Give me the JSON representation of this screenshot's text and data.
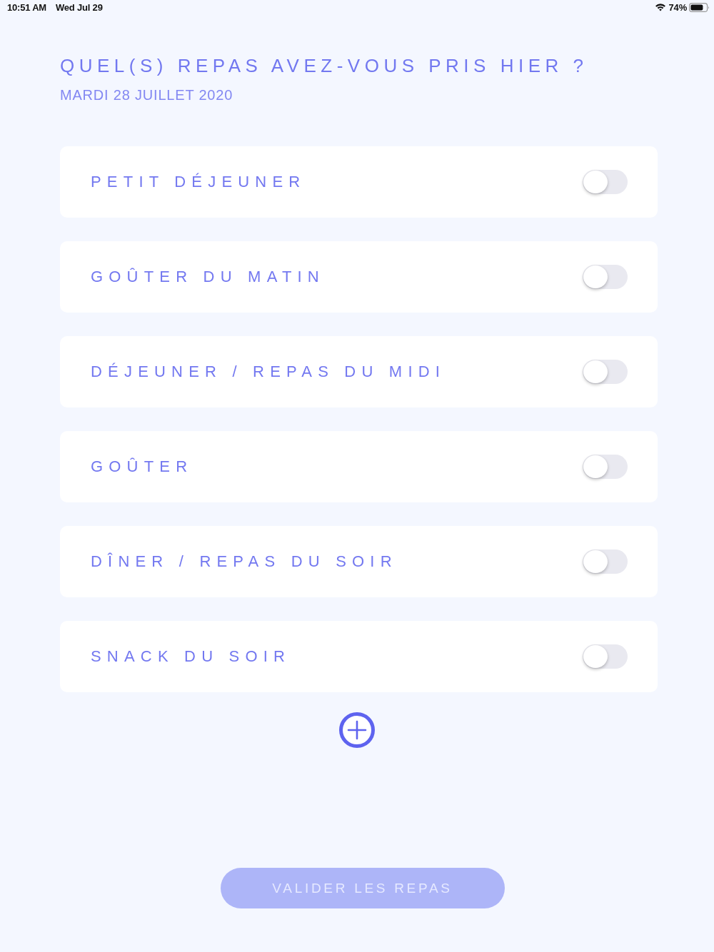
{
  "status_bar": {
    "time": "10:51 AM",
    "date": "Wed Jul 29",
    "battery": "74%"
  },
  "header": {
    "title": "QUEL(S) REPAS AVEZ-VOUS PRIS HIER ?",
    "date": "MARDI 28 JUILLET 2020"
  },
  "meals": [
    {
      "label": "PETIT DÉJEUNER",
      "on": false
    },
    {
      "label": "GOÛTER DU MATIN",
      "on": false
    },
    {
      "label": "DÉJEUNER / REPAS DU MIDI",
      "on": false
    },
    {
      "label": "GOÛTER",
      "on": false
    },
    {
      "label": "DÎNER / REPAS DU SOIR",
      "on": false
    },
    {
      "label": "SNACK DU SOIR",
      "on": false
    }
  ],
  "submit_button": {
    "label": "VALIDER LES REPAS",
    "disabled": true
  }
}
